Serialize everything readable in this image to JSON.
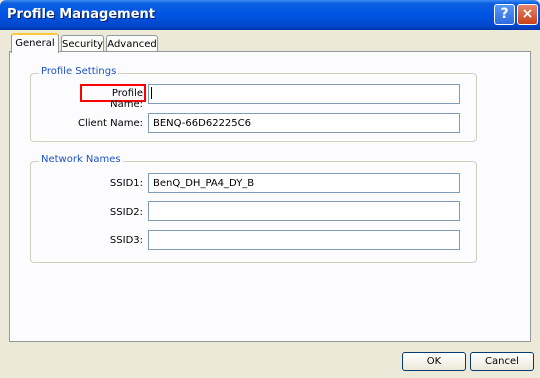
{
  "window": {
    "title": "Profile Management",
    "help_glyph": "?",
    "close_glyph": "×"
  },
  "tabs": [
    {
      "label": "General",
      "active": true
    },
    {
      "label": "Security",
      "active": false
    },
    {
      "label": "Advanced",
      "active": false
    }
  ],
  "profile_settings": {
    "legend": "Profile Settings",
    "profile_name_label": "Profile Name:",
    "profile_name_value": "",
    "client_name_label": "Client Name:",
    "client_name_value": "BENQ-66D62225C6"
  },
  "network_names": {
    "legend": "Network Names",
    "ssid1_label": "SSID1:",
    "ssid1_value": "BenQ_DH_PA4_DY_B",
    "ssid2_label": "SSID2:",
    "ssid2_value": "",
    "ssid3_label": "SSID3:",
    "ssid3_value": ""
  },
  "buttons": {
    "ok": "OK",
    "cancel": "Cancel"
  },
  "colors": {
    "titlebar": "#0054e3",
    "highlight": "#ff0000",
    "legend_text": "#1e52c8"
  }
}
